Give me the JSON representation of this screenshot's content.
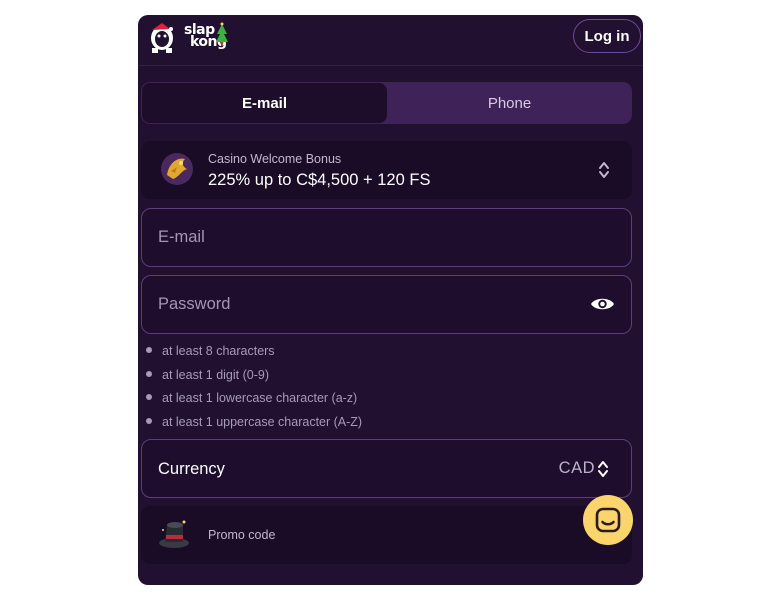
{
  "header": {
    "logo_line1": "slap",
    "logo_line2": "kong",
    "login_label": "Log in"
  },
  "tabs": [
    {
      "label": "E-mail",
      "active": true
    },
    {
      "label": "Phone",
      "active": false
    }
  ],
  "bonus": {
    "subtitle": "Casino Welcome Bonus",
    "title": "225% up to C$4,500 + 120 FS",
    "icon": "gold-dragon-icon"
  },
  "form": {
    "email_placeholder": "E-mail",
    "password_placeholder": "Password",
    "password_rules": [
      "at least 8 characters",
      "at least 1 digit (0-9)",
      "at least 1 lowercase character (a-z)",
      "at least 1 uppercase character (A-Z)"
    ],
    "currency_label": "Currency",
    "currency_value": "CAD",
    "promo_label": "Promo code",
    "promo_icon": "magic-hat-icon"
  },
  "chat": {
    "icon": "chat-icon"
  },
  "colors": {
    "panel_bg": "#21102f",
    "accent_purple": "#3e2258",
    "chat_yellow": "#fbd56b",
    "input_border": "#5b3e7c"
  }
}
